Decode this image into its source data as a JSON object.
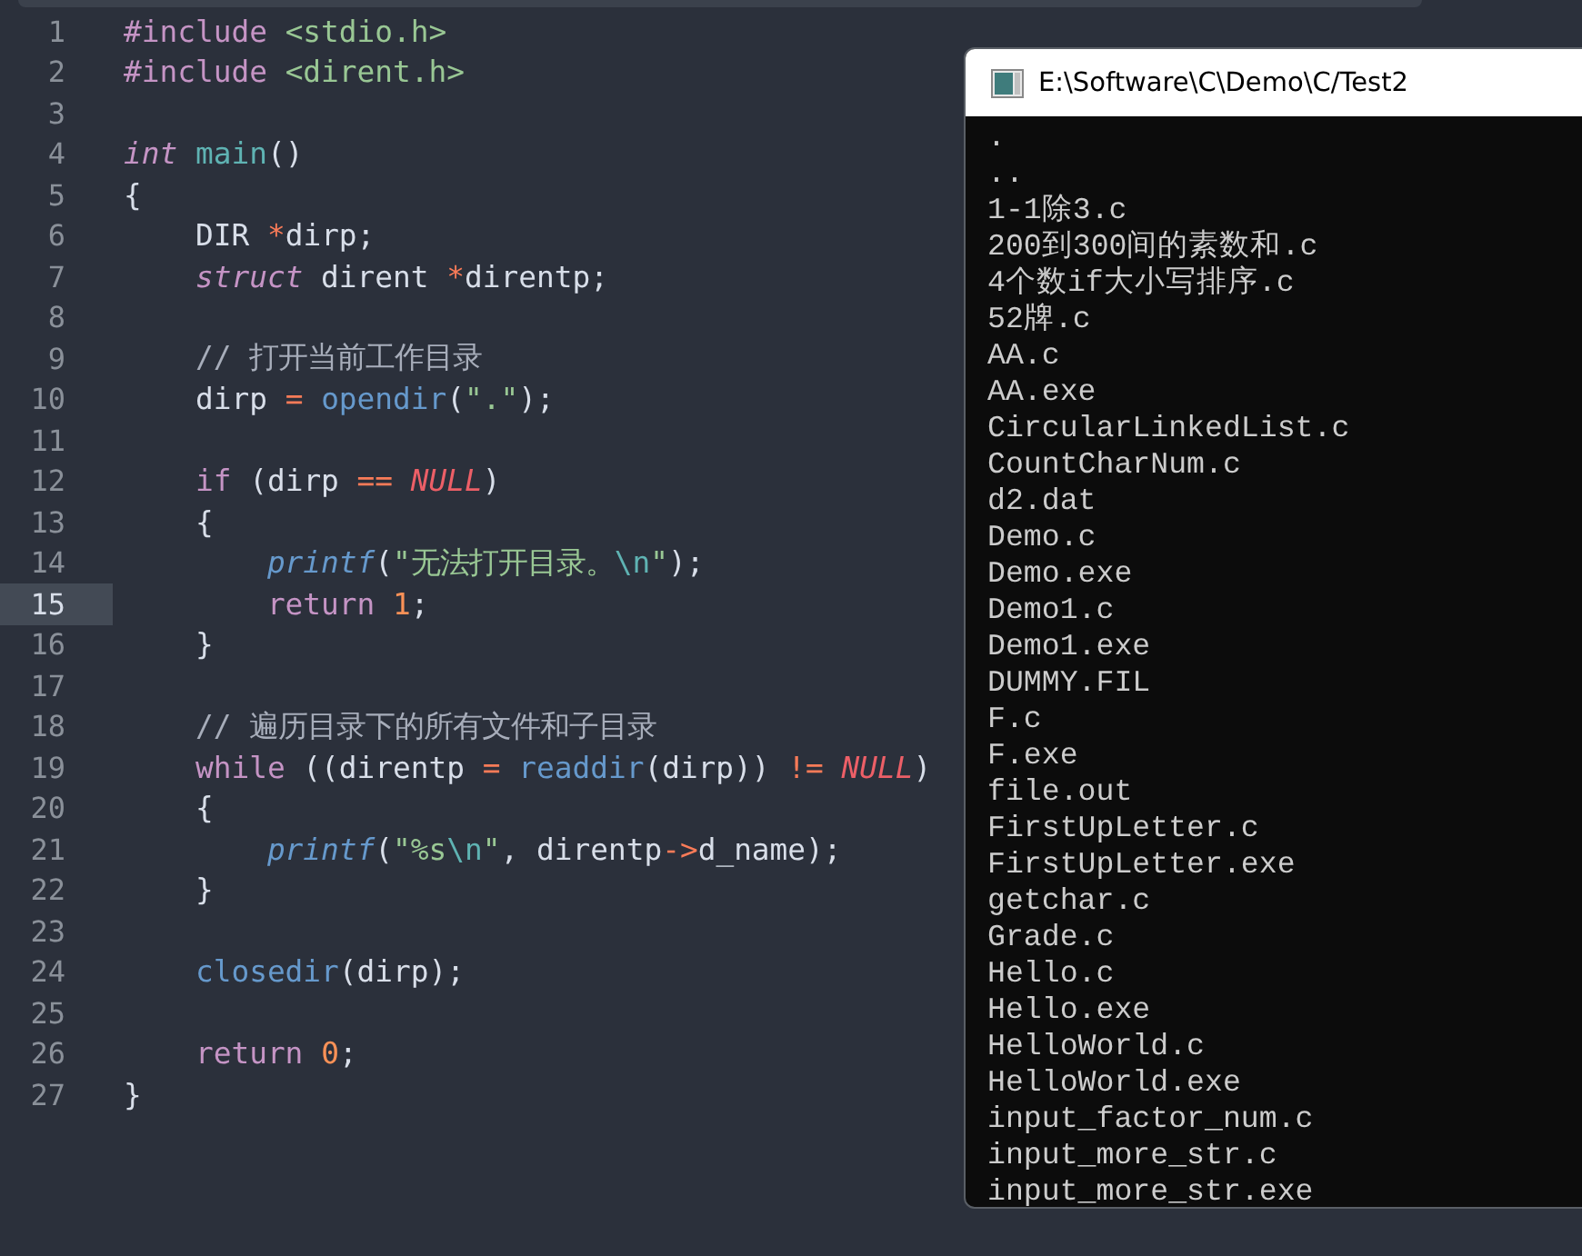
{
  "editor": {
    "lines": [
      {
        "number": "1",
        "current": false,
        "tokens": [
          {
            "kind": "preproc",
            "text": "#include "
          },
          {
            "kind": "path",
            "text": "<stdio.h>"
          }
        ]
      },
      {
        "number": "2",
        "current": false,
        "tokens": [
          {
            "kind": "preproc",
            "text": "#include "
          },
          {
            "kind": "path",
            "text": "<dirent.h>"
          }
        ]
      },
      {
        "number": "3",
        "current": false
      },
      {
        "number": "4",
        "current": false,
        "tokens": [
          {
            "kind": "type",
            "text": "int"
          },
          {
            "kind": "defname",
            "text": " main"
          },
          {
            "kind": "plain",
            "text": "()"
          }
        ]
      },
      {
        "number": "5",
        "current": false,
        "tokens": [
          {
            "kind": "plain",
            "text": "{"
          }
        ]
      },
      {
        "number": "6",
        "current": false,
        "tokens": [
          {
            "kind": "plain",
            "text": "    DIR "
          },
          {
            "kind": "operator",
            "text": "*"
          },
          {
            "kind": "plain",
            "text": "dirp;"
          }
        ]
      },
      {
        "number": "7",
        "current": false,
        "tokens": [
          {
            "kind": "type",
            "text": "    struct"
          },
          {
            "kind": "plain",
            "text": " dirent "
          },
          {
            "kind": "operator",
            "text": "*"
          },
          {
            "kind": "plain",
            "text": "direntp;"
          }
        ]
      },
      {
        "number": "8",
        "current": false
      },
      {
        "number": "9",
        "current": false,
        "tokens": [
          {
            "kind": "comment",
            "text": "    // 打开当前工作目录"
          }
        ]
      },
      {
        "number": "10",
        "current": false,
        "tokens": [
          {
            "kind": "plain",
            "text": "    dirp "
          },
          {
            "kind": "operator",
            "text": "= "
          },
          {
            "kind": "call",
            "text": "opendir"
          },
          {
            "kind": "plain",
            "text": "("
          },
          {
            "kind": "string",
            "text": "\".\""
          },
          {
            "kind": "plain",
            "text": ");"
          }
        ]
      },
      {
        "number": "11",
        "current": false
      },
      {
        "number": "12",
        "current": false,
        "tokens": [
          {
            "kind": "keyword",
            "text": "    if"
          },
          {
            "kind": "plain",
            "text": " (dirp "
          },
          {
            "kind": "operator",
            "text": "== "
          },
          {
            "kind": "constant",
            "text": "NULL"
          },
          {
            "kind": "plain",
            "text": ")"
          }
        ]
      },
      {
        "number": "13",
        "current": false,
        "tokens": [
          {
            "kind": "plain",
            "text": "    {"
          }
        ]
      },
      {
        "number": "14",
        "current": false,
        "tokens": [
          {
            "kind": "libcall",
            "text": "        printf"
          },
          {
            "kind": "plain",
            "text": "("
          },
          {
            "kind": "string",
            "text": "\"无法打开目录。"
          },
          {
            "kind": "escape",
            "text": "\\n"
          },
          {
            "kind": "string",
            "text": "\""
          },
          {
            "kind": "plain",
            "text": ");"
          }
        ]
      },
      {
        "number": "15",
        "current": true,
        "tokens": [
          {
            "kind": "keyword",
            "text": "        return "
          },
          {
            "kind": "number",
            "text": "1"
          },
          {
            "kind": "plain",
            "text": ";"
          }
        ]
      },
      {
        "number": "16",
        "current": false,
        "tokens": [
          {
            "kind": "plain",
            "text": "    }"
          }
        ]
      },
      {
        "number": "17",
        "current": false
      },
      {
        "number": "18",
        "current": false,
        "tokens": [
          {
            "kind": "comment",
            "text": "    // 遍历目录下的所有文件和子目录"
          }
        ]
      },
      {
        "number": "19",
        "current": false,
        "tokens": [
          {
            "kind": "keyword",
            "text": "    while"
          },
          {
            "kind": "plain",
            "text": " ((direntp "
          },
          {
            "kind": "operator",
            "text": "= "
          },
          {
            "kind": "call",
            "text": "readdir"
          },
          {
            "kind": "plain",
            "text": "(dirp)) "
          },
          {
            "kind": "operator",
            "text": "!= "
          },
          {
            "kind": "constant",
            "text": "NULL"
          },
          {
            "kind": "plain",
            "text": ")"
          }
        ]
      },
      {
        "number": "20",
        "current": false,
        "tokens": [
          {
            "kind": "plain",
            "text": "    {"
          }
        ]
      },
      {
        "number": "21",
        "current": false,
        "tokens": [
          {
            "kind": "libcall",
            "text": "        printf"
          },
          {
            "kind": "plain",
            "text": "("
          },
          {
            "kind": "string",
            "text": "\"%s"
          },
          {
            "kind": "escape",
            "text": "\\n"
          },
          {
            "kind": "string",
            "text": "\""
          },
          {
            "kind": "plain",
            "text": ", direntp"
          },
          {
            "kind": "operator",
            "text": "->"
          },
          {
            "kind": "plain",
            "text": "d_name);"
          }
        ]
      },
      {
        "number": "22",
        "current": false,
        "tokens": [
          {
            "kind": "plain",
            "text": "    }"
          }
        ]
      },
      {
        "number": "23",
        "current": false
      },
      {
        "number": "24",
        "current": false,
        "tokens": [
          {
            "kind": "call",
            "text": "    closedir"
          },
          {
            "kind": "plain",
            "text": "(dirp);"
          }
        ]
      },
      {
        "number": "25",
        "current": false
      },
      {
        "number": "26",
        "current": false,
        "tokens": [
          {
            "kind": "keyword",
            "text": "    return "
          },
          {
            "kind": "number",
            "text": "0"
          },
          {
            "kind": "plain",
            "text": ";"
          }
        ]
      },
      {
        "number": "27",
        "current": false,
        "tokens": [
          {
            "kind": "plain",
            "text": "}"
          }
        ]
      }
    ]
  },
  "console": {
    "title": "E:\\Software\\C\\Demo\\C/Test2",
    "lines": [
      ".",
      "..",
      "1-1除3.c",
      "200到300间的素数和.c",
      "4个数if大小写排序.c",
      "52牌.c",
      "AA.c",
      "AA.exe",
      "CircularLinkedList.c",
      "CountCharNum.c",
      "d2.dat",
      "Demo.c",
      "Demo.exe",
      "Demo1.c",
      "Demo1.exe",
      "DUMMY.FIL",
      "F.c",
      "F.exe",
      "file.out",
      "FirstUpLetter.c",
      "FirstUpLetter.exe",
      "getchar.c",
      "Grade.c",
      "Hello.c",
      "Hello.exe",
      "HelloWorld.c",
      "HelloWorld.exe",
      "input_factor_num.c",
      "input_more_str.c",
      "input_more_str.exe"
    ]
  }
}
